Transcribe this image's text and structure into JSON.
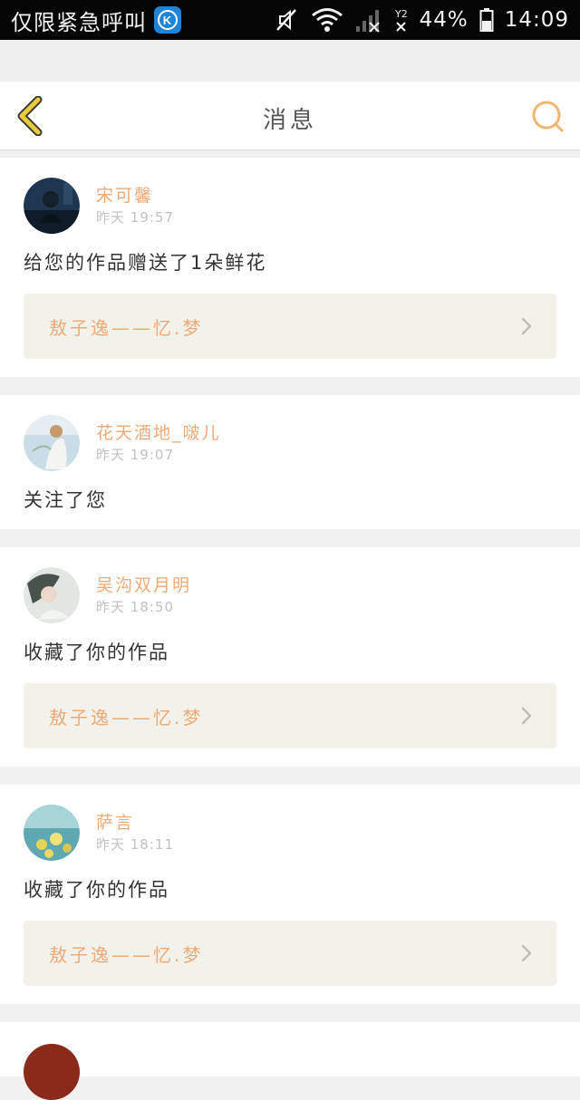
{
  "status_bar": {
    "carrier_text": "仅限紧急呼叫",
    "app_badge_letter": "K",
    "battery_percent": "44%",
    "signal_label": "2",
    "time": "14:09",
    "icons": [
      "mute-icon",
      "wifi-icon",
      "signal-icon",
      "battery-icon"
    ]
  },
  "header": {
    "title": "消息",
    "back_icon": "chevron-left-icon",
    "search_icon": "search-icon",
    "accent_color": "#f0b56e",
    "back_color": "#e9c83a"
  },
  "messages": [
    {
      "name": "宋可馨",
      "time": "昨天 19:57",
      "action": "给您的作品赠送了1朵鲜花",
      "work_title": "敖子逸——忆.梦",
      "avatar_palette": [
        "#1e3550",
        "#0d1c2c"
      ]
    },
    {
      "name": "花天酒地_啵儿",
      "time": "昨天 19:07",
      "action": "关注了您",
      "work_title": "",
      "avatar_palette": [
        "#b8d4e4",
        "#e8eef2"
      ]
    },
    {
      "name": "吴沟双月明",
      "time": "昨天 18:50",
      "action": "收藏了你的作品",
      "work_title": "敖子逸——忆.梦",
      "avatar_palette": [
        "#5e6a62",
        "#dfe4e0"
      ]
    },
    {
      "name": "萨言",
      "time": "昨天 18:11",
      "action": "收藏了你的作品",
      "work_title": "敖子逸——忆.梦",
      "avatar_palette": [
        "#3f8e9c",
        "#d7c862"
      ]
    }
  ],
  "colors": {
    "name_color": "#eeaa77",
    "time_color": "#c2c2c2",
    "link_bg": "#f2f1ea",
    "page_bg": "#f1f1f1"
  }
}
